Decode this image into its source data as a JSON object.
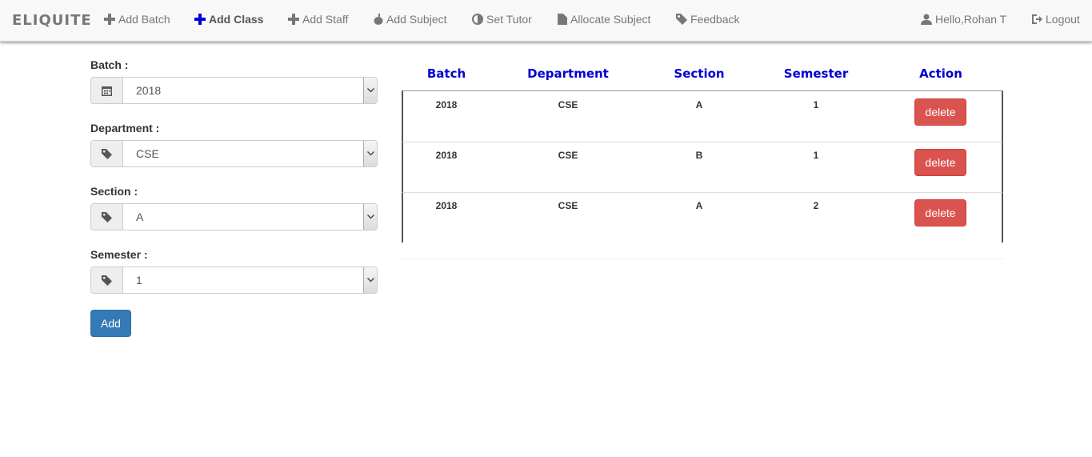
{
  "navbar": {
    "brand": "ELIQUITE",
    "items": [
      {
        "label": "Add Batch",
        "icon": "plus-icon"
      },
      {
        "label": "Add Class",
        "icon": "plus-icon"
      },
      {
        "label": "Add Staff",
        "icon": "plus-icon"
      },
      {
        "label": "Add Subject",
        "icon": "apple-icon"
      },
      {
        "label": "Set Tutor",
        "icon": "adjust-icon"
      },
      {
        "label": "Allocate Subject",
        "icon": "file-icon"
      },
      {
        "label": "Feedback",
        "icon": "tag-icon"
      }
    ],
    "user": "Hello,Rohan T",
    "logout": "Logout",
    "active_color": "#0000d4"
  },
  "form": {
    "batch_label": "Batch :",
    "batch_value": "2018",
    "department_label": "Department :",
    "department_value": "CSE",
    "section_label": "Section :",
    "section_value": "A",
    "semester_label": "Semester :",
    "semester_value": "1",
    "add_label": "Add"
  },
  "table": {
    "headers": [
      "Batch",
      "Department",
      "Section",
      "Semester",
      "Action"
    ],
    "rows": [
      {
        "batch": "2018",
        "department": "CSE",
        "section": "A",
        "semester": "1",
        "action": "delete"
      },
      {
        "batch": "2018",
        "department": "CSE",
        "section": "B",
        "semester": "1",
        "action": "delete"
      },
      {
        "batch": "2018",
        "department": "CSE",
        "section": "A",
        "semester": "2",
        "action": "delete"
      }
    ],
    "header_color": "#0000d4",
    "delete_color": "#d9534f"
  }
}
